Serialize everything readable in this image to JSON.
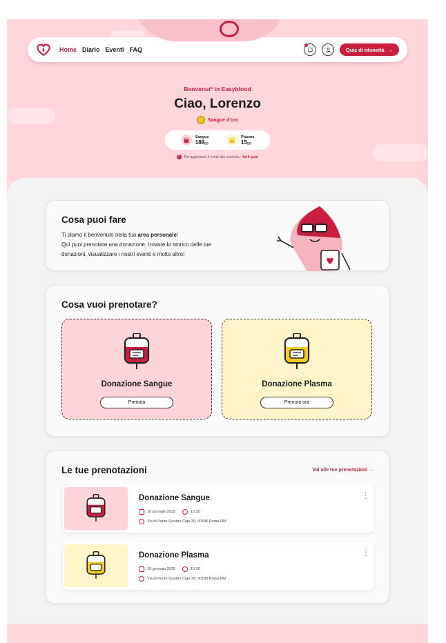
{
  "nav": {
    "links": [
      "Home",
      "Diario",
      "Eventi",
      "FAQ"
    ],
    "quiz_button": "Quiz di idoneità"
  },
  "hero": {
    "welcome": "Benvenut* in Easyblood",
    "greeting": "Ciao, Lorenzo",
    "badge": "Sangue d'oro",
    "counters": [
      {
        "name": "Sangue",
        "value": "188",
        "unit": "gg"
      },
      {
        "name": "Plasma",
        "value": "15",
        "unit": "gg"
      }
    ],
    "note_prefix": "Per aggiornare il conto alla rovescia,",
    "note_link": "fai il quiz!"
  },
  "intro": {
    "title": "Cosa puoi fare",
    "line1_start": "Ti diamo il benvenuto nella tua ",
    "line1_bold": "area personale",
    "line1_end": "!",
    "line2": "Qui puoi prenotare una donazione, trovare lo storico delle tue donazioni, visualizzare i nostri eventi e molto altro!"
  },
  "booking_choice": {
    "title": "Cosa vuoi prenotare?",
    "options": [
      {
        "title": "Donazione Sangue",
        "button": "Prenota"
      },
      {
        "title": "Donazione Plasma",
        "button": "Prenota ora"
      }
    ]
  },
  "bookings": {
    "title": "Le tue prenotazioni",
    "link": "Vai alle tue prenotazioni",
    "items": [
      {
        "title": "Donazione Sangue",
        "date": "10 gennaio 2025",
        "time": "10:30",
        "address": "Via di Ponte Quattro Capi 39, 00186 Roma RM"
      },
      {
        "title": "Donazione Plasma",
        "date": "10 gennaio 2025",
        "time": "10:30",
        "address": "Via di Ponte Quattro Capi 39, 00186 Roma RM"
      }
    ]
  },
  "colors": {
    "accent": "#c81e3f",
    "pink_bg": "#ffd6dc",
    "blood_card": "#ffd3da",
    "plasma_card": "#fff5c8"
  }
}
